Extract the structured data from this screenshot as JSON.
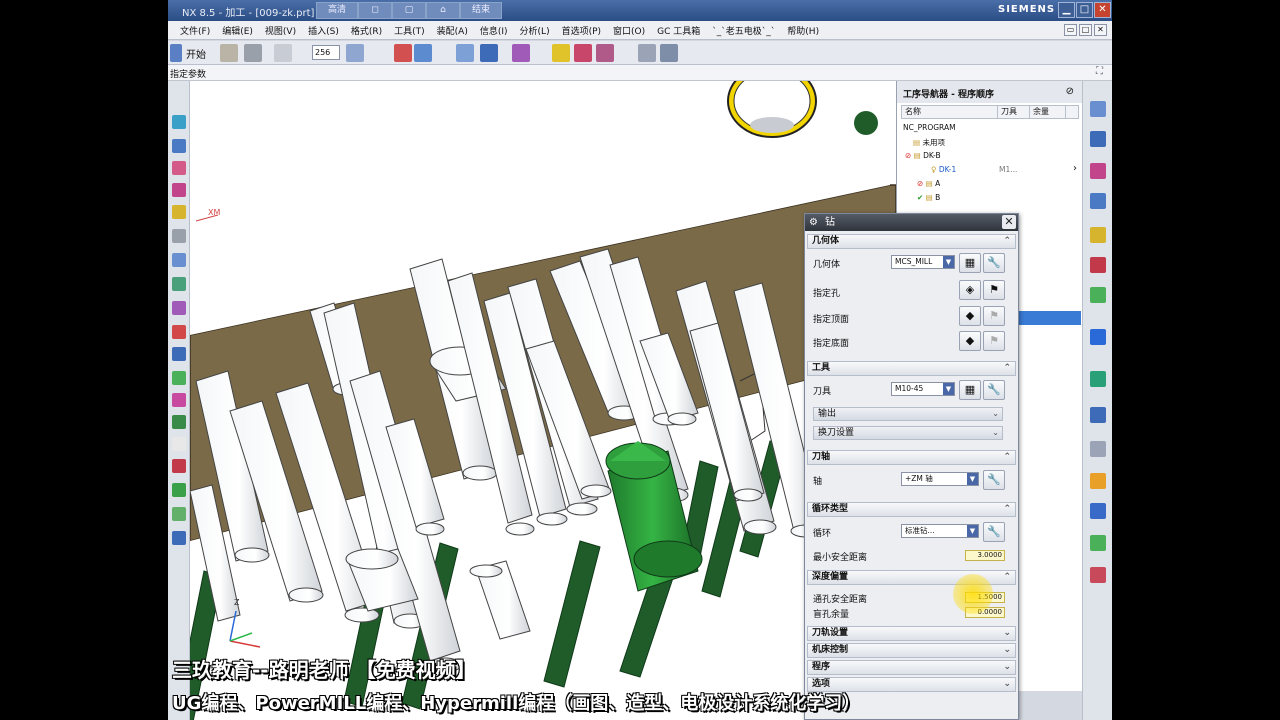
{
  "window": {
    "title": "NX 8.5 - 加工 - [009-zk.prt]",
    "center_buttons": [
      "高清",
      "结束"
    ],
    "brand": "SIEMENS"
  },
  "menubar": {
    "items": [
      "文件(F)",
      "编辑(E)",
      "视图(V)",
      "插入(S)",
      "格式(R)",
      "工具(T)",
      "装配(A)",
      "信息(I)",
      "分析(L)",
      "首选项(P)",
      "窗口(O)",
      "GC 工具箱",
      "`_`老五电极`_`",
      "帮助(H)"
    ]
  },
  "toolbar": {
    "start_label": "开始",
    "combo_value": "256"
  },
  "prompt": {
    "text": "指定参数"
  },
  "viewport": {
    "axis_label": "XM"
  },
  "navigator": {
    "title": "工序导航器 - 程序顺序",
    "columns": [
      "名称",
      "刀具",
      "余量"
    ],
    "rows": [
      "NC_PROGRAM",
      "未用项",
      "DK-B",
      "DK-1",
      "A",
      "B"
    ],
    "tool_value": "M1..."
  },
  "dialog": {
    "title": "钻",
    "geometry_section": "几何体",
    "geometry_label": "几何体",
    "geometry_value": "MCS_MILL",
    "specify_holes": "指定孔",
    "specify_top": "指定顶面",
    "specify_bottom": "指定底面",
    "tool_section": "工具",
    "tool_label": "刀具",
    "tool_value": "M10-45",
    "output_label": "输出",
    "toolchange_label": "换刀设置",
    "axis_section": "刀轴",
    "axis_label": "轴",
    "axis_value": "+ZM 轴",
    "cycle_section": "循环类型",
    "cycle_label": "循环",
    "cycle_value": "标准钻...",
    "min_clearance_label": "最小安全距离",
    "min_clearance_value": "3.0000",
    "depth_offset_section": "深度偏置",
    "through_clearance_label": "通孔安全距离",
    "through_clearance_value": "1.5000",
    "blind_stock_label": "盲孔余量",
    "blind_stock_value": "0.0000",
    "path_settings": "刀轨设置",
    "machine_control": "机床控制",
    "program": "程序",
    "options": "选项"
  },
  "captions": {
    "line1": "三玖教育--路明老师  【免费视频】",
    "line2": "UG编程、PowerMILL编程、Hypermill编程（画图、造型、电极设计系统化学习）"
  },
  "colors": {
    "plate": "#7a6a48",
    "tube_fill": "#ffffff",
    "pin_green": "#1f5c2a",
    "drill_green": "#2f9e3c",
    "accent_yellow": "#f2d500"
  }
}
